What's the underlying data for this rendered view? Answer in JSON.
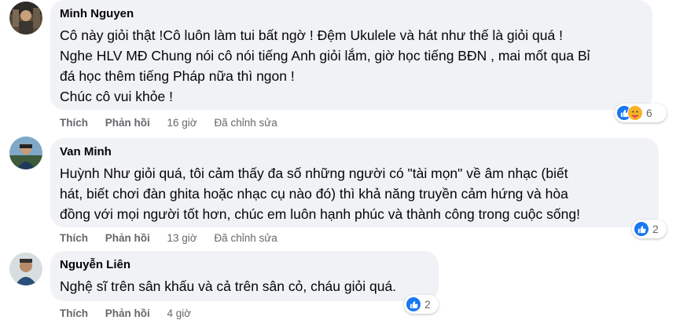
{
  "comments": [
    {
      "author": "Minh Nguyen",
      "lines": [
        "Cô này giỏi thật !Cô luôn làm tui bất ngờ ! Đệm Ukulele và hát như thế là giỏi quá !",
        "Nghe HLV MĐ Chung nói cô nói tiếng Anh giỏi lắm, giờ học tiếng BĐN , mai mốt qua Bỉ",
        "đá học thêm tiếng Pháp nữa thì ngon !",
        "Chúc cô vui khỏe !"
      ],
      "like_label": "Thích",
      "reply_label": "Phản hồi",
      "time": "16 giờ",
      "edited": "Đã chỉnh sửa",
      "reaction_count": "6",
      "reaction_icons": [
        "like-icon",
        "care-icon"
      ]
    },
    {
      "author": "Van Minh",
      "lines": [
        "Huỳnh Như giỏi quá, tôi cảm thấy đa số những người có \"tài mọn\" về âm nhạc (biết",
        "hát, biết chơi đàn ghita hoặc nhạc cụ nào đó) thì khả năng truyền cảm hứng và hòa",
        "đồng với mọi người tốt hơn, chúc em luôn hạnh phúc và thành công trong cuộc sống!"
      ],
      "like_label": "Thích",
      "reply_label": "Phản hồi",
      "time": "13 giờ",
      "edited": "Đã chỉnh sửa",
      "reaction_count": "2",
      "reaction_icons": [
        "like-icon"
      ]
    },
    {
      "author": "Nguyễn Liên",
      "lines": [
        "Nghệ sĩ trên sân khấu và cả trên sân cỏ, cháu giỏi quá."
      ],
      "like_label": "Thích",
      "reply_label": "Phản hồi",
      "time": "4 giờ",
      "reaction_count": "2",
      "reaction_icons": [
        "like-icon"
      ]
    }
  ],
  "colors": {
    "bubble": "#f0f2f5",
    "meta_text": "#65676b",
    "like_blue": "#1877f2",
    "care_yellow": "#f7b125"
  }
}
